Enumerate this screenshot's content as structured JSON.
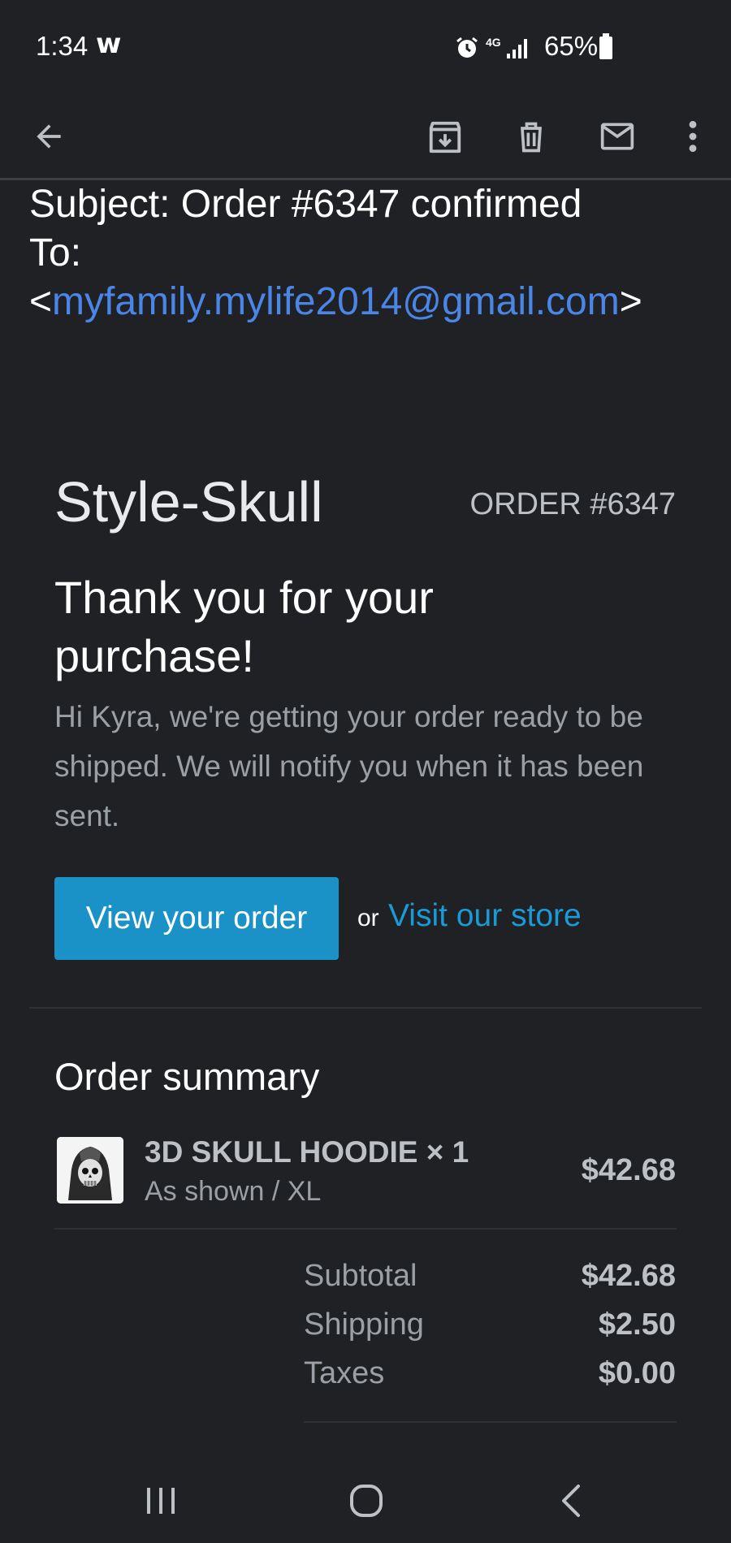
{
  "status_bar": {
    "time": "1:34",
    "notification_glyph": "w",
    "network_label": "4G",
    "battery_percent": "65%",
    "icons": [
      "alarm-icon",
      "signal-icon",
      "battery-icon"
    ]
  },
  "app_bar": {
    "icons": [
      "back-arrow-icon",
      "archive-icon",
      "delete-icon",
      "mark-unread-icon",
      "more-vert-icon"
    ]
  },
  "email": {
    "subject_line": "Subject: Order #6347 confirmed",
    "to_label": "To:",
    "to_open": "<",
    "to_address": "myfamily.mylife2014@gmail.com",
    "to_close": ">"
  },
  "order": {
    "shop_name": "Style-Skull",
    "order_number": "ORDER #6347",
    "heading": "Thank you for your purchase!",
    "message": "Hi Kyra, we're getting your order ready to be shipped. We will notify you when it has been sent.",
    "view_order_button": "View your order",
    "or_text": "or",
    "visit_store_link": "Visit our store"
  },
  "summary": {
    "title": "Order summary",
    "items": [
      {
        "name": "3D SKULL HOODIE × 1",
        "variant": "As shown / XL",
        "price": "$42.68"
      }
    ],
    "totals": [
      {
        "label": "Subtotal",
        "value": "$42.68"
      },
      {
        "label": "Shipping",
        "value": "$2.50"
      },
      {
        "label": "Taxes",
        "value": "$0.00"
      }
    ]
  },
  "nav_bar": {
    "icons": [
      "recent-apps-icon",
      "home-icon",
      "back-icon"
    ]
  },
  "colors": {
    "background": "#202124",
    "accent_button": "#1a92c8",
    "link": "#4a86e8"
  }
}
